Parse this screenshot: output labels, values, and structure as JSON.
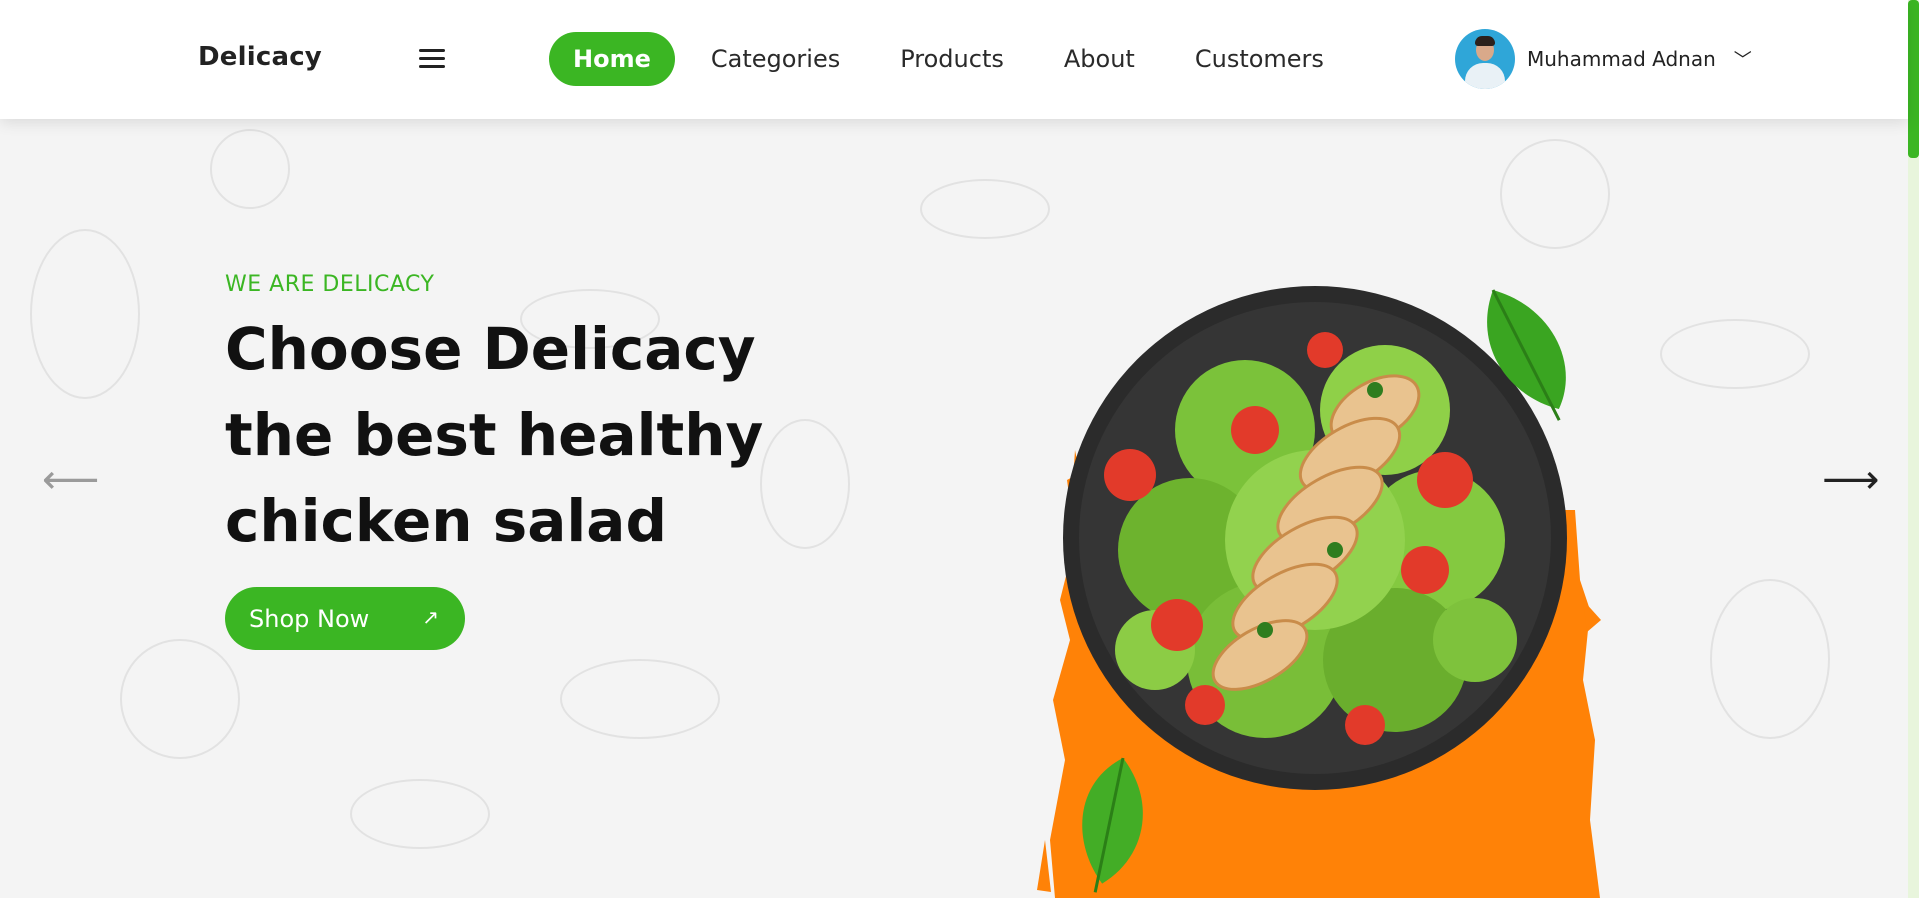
{
  "header": {
    "brand": "Delicacy",
    "nav": [
      {
        "label": "Home",
        "active": true
      },
      {
        "label": "Categories",
        "active": false
      },
      {
        "label": "Products",
        "active": false
      },
      {
        "label": "About",
        "active": false
      },
      {
        "label": "Customers",
        "active": false
      }
    ],
    "user": {
      "name": "Muhammad Adnan",
      "chevron": "﹀"
    }
  },
  "hero": {
    "eyebrow": "WE ARE DELICACY",
    "headline": [
      "Choose Delicacy",
      "the best healthy",
      "chicken salad"
    ],
    "cta_label": "Shop Now",
    "cta_icon": "↗",
    "prev_icon": "⟵",
    "next_icon": "⟶"
  },
  "colors": {
    "accent": "#3bb623",
    "orange": "#ff8207",
    "plate": "#2b2b2b",
    "background": "#f4f4f4"
  },
  "icons": [
    "menu-icon",
    "chevron-down-icon",
    "arrow-up-right-icon",
    "arrow-left-icon",
    "arrow-right-icon",
    "leaf-icon"
  ]
}
